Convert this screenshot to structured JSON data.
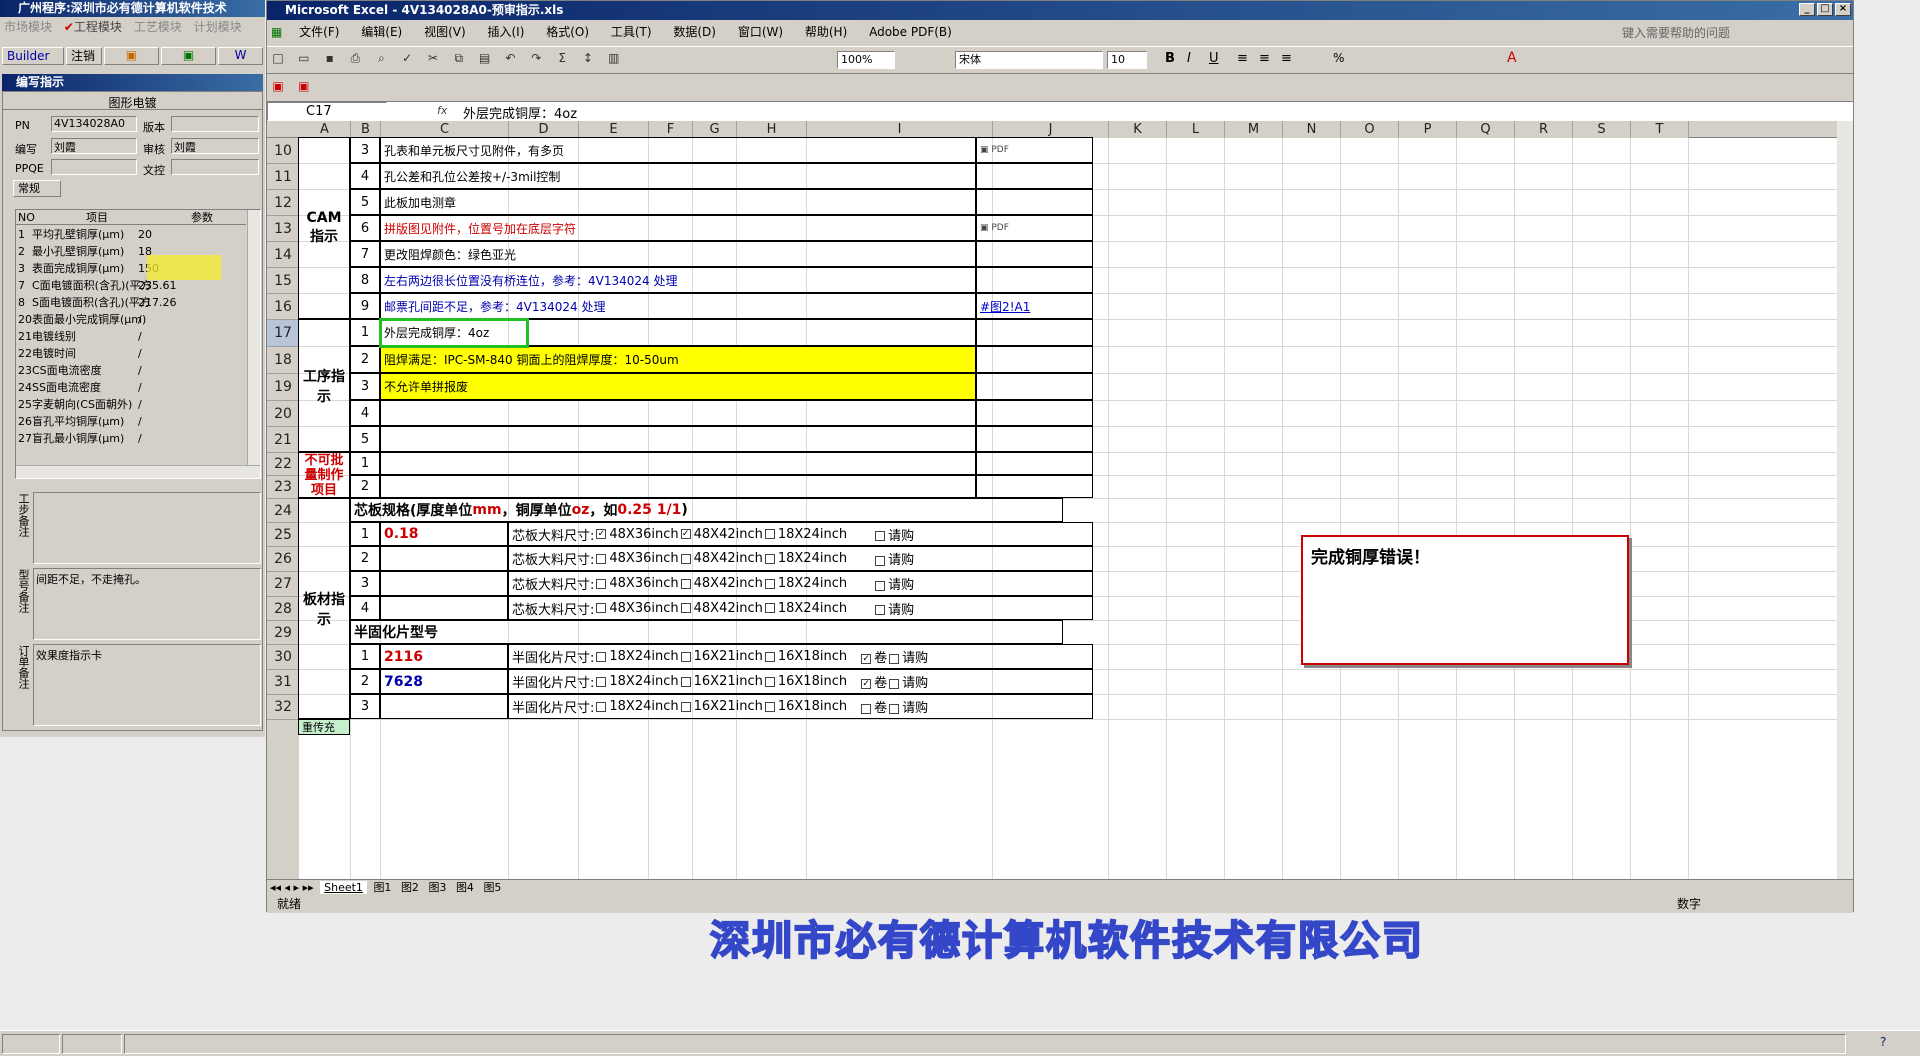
{
  "app": {
    "outer_title": "广州程序:深圳市必有德计算机软件技术",
    "outer_menu": [
      "市场模块",
      "工程模块",
      "工艺模块",
      "计划模块"
    ],
    "excel_title": "Microsoft Excel - 4V134028A0-预审指示.xls",
    "help_placeholder": "键入需要帮助的问题",
    "company_banner": "深圳市必有德计算机软件技术有限公司"
  },
  "left_panel": {
    "toolbar": [
      "Builder",
      "注销"
    ],
    "panel_title": "编写指示",
    "subtitle": "图形电镀",
    "fields": {
      "pn_label": "PN",
      "pn_value": "4V134028A0",
      "version_label": "版本",
      "version_value": "",
      "author_label": "编写",
      "author_value": "刘霞",
      "reviewer_label": "审核",
      "reviewer_value": "刘霞",
      "ppqe_label": "PPQE",
      "ppqe_value": "",
      "doc_label": "文控",
      "doc_value": ""
    },
    "tab_label": "常规",
    "table_headers": [
      "NO",
      "项目",
      "参数"
    ],
    "table_rows": [
      {
        "no": "1",
        "item": "平均孔壁铜厚(μm)",
        "val": "20"
      },
      {
        "no": "2",
        "item": "最小孔壁铜厚(μm)",
        "val": "18"
      },
      {
        "no": "3",
        "item": "表面完成铜厚(μm)",
        "val": "150"
      },
      {
        "no": "7",
        "item": "C面电镀面积(含孔)(平方",
        "val": "235.61"
      },
      {
        "no": "8",
        "item": "S面电镀面积(含孔)(平方",
        "val": "217.26"
      },
      {
        "no": "20",
        "item": "表面最小完成铜厚(μm)",
        "val": "/"
      },
      {
        "no": "21",
        "item": "电镀线别",
        "val": "/"
      },
      {
        "no": "22",
        "item": "电镀时间",
        "val": "/"
      },
      {
        "no": "23",
        "item": "CS面电流密度",
        "val": "/"
      },
      {
        "no": "24",
        "item": "SS面电流密度",
        "val": "/"
      },
      {
        "no": "25",
        "item": "字麦朝向(CS面朝外)",
        "val": "/"
      },
      {
        "no": "26",
        "item": "盲孔平均铜厚(μm)",
        "val": "/"
      },
      {
        "no": "27",
        "item": "盲孔最小铜厚(μm)",
        "val": "/"
      }
    ],
    "notes": [
      {
        "label": "工步备注",
        "text": ""
      },
      {
        "label": "型号备注",
        "text": "间距不足，不走掩孔。"
      },
      {
        "label": "订单备注",
        "text": "效果度指示卡"
      }
    ]
  },
  "excel": {
    "menu": [
      "文件(F)",
      "编辑(E)",
      "视图(V)",
      "插入(I)",
      "格式(O)",
      "工具(T)",
      "数据(D)",
      "窗口(W)",
      "帮助(H)",
      "Adobe PDF(B)"
    ],
    "zoom": "100%",
    "font_name": "宋体",
    "font_size": "10",
    "name_box": "C17",
    "fx": "fx",
    "formula": "外层完成铜厚：4oz",
    "col_headers": [
      "A",
      "B",
      "C",
      "D",
      "E",
      "F",
      "G",
      "H",
      "I",
      "J",
      "K",
      "L",
      "M",
      "N",
      "O",
      "P",
      "Q",
      "R",
      "S",
      "T"
    ],
    "row_numbers": [
      "10",
      "11",
      "12",
      "13",
      "14",
      "15",
      "16",
      "17",
      "18",
      "19",
      "20",
      "21",
      "22",
      "23",
      "24",
      "25",
      "26",
      "27",
      "28",
      "29",
      "30",
      "31",
      "32"
    ],
    "sections": {
      "cam": "CAM指示",
      "process": "工序指示",
      "nobatch": "不可批量制作项目",
      "material": "板材指示",
      "bottom": "重传充"
    },
    "cam_rows": [
      {
        "no": "3",
        "text": "孔表和单元板尺寸见附件，有多页",
        "link": ""
      },
      {
        "no": "4",
        "text": "孔公差和孔位公差按+/-3mil控制",
        "link": ""
      },
      {
        "no": "5",
        "text": "此板加电测章",
        "link": ""
      },
      {
        "no": "6",
        "text": "拼版图见附件，位置号加在底层字符",
        "link": ""
      },
      {
        "no": "7",
        "text": "更改阻焊颜色：绿色亚光",
        "link": ""
      },
      {
        "no": "8",
        "text": "左右两边很长位置没有桥连位，参考：4V134024 处理",
        "link": ""
      },
      {
        "no": "9",
        "text": "邮票孔间距不足，参考：4V134024 处理",
        "link": "#图2!A1"
      }
    ],
    "process_rows": [
      {
        "no": "1",
        "text": "外层完成铜厚：4oz"
      },
      {
        "no": "2",
        "text": "阻焊满足：IPC-SM-840 铜面上的阻焊厚度：10-50um"
      },
      {
        "no": "3",
        "text": "不允许单拼报废"
      },
      {
        "no": "4",
        "text": ""
      },
      {
        "no": "5",
        "text": ""
      }
    ],
    "nobatch_rows": [
      {
        "no": "1"
      },
      {
        "no": "2"
      }
    ],
    "core_header_a": "芯板规格(厚度单位",
    "core_header_mm": "mm",
    "core_header_b": "，铜厚单位",
    "core_header_oz": "oz",
    "core_header_c": "，如",
    "core_header_ex": "0.25 1/1",
    "core_header_d": ")",
    "core_label": "芯板大料尺寸:",
    "core_options": [
      "48X36inch",
      "48X42inch",
      "18X24inch",
      "请购"
    ],
    "core_rows": [
      {
        "no": "1",
        "spec": "0.18",
        "checks": [
          true,
          true,
          false,
          false
        ]
      },
      {
        "no": "2",
        "spec": "",
        "checks": [
          false,
          false,
          false,
          false
        ]
      },
      {
        "no": "3",
        "spec": "",
        "checks": [
          false,
          false,
          false,
          false
        ]
      },
      {
        "no": "4",
        "spec": "",
        "checks": [
          false,
          false,
          false,
          false
        ]
      }
    ],
    "pp_header": "半固化片型号",
    "pp_label": "半固化片尺寸:",
    "pp_options": [
      "18X24inch",
      "16X21inch",
      "16X18inch",
      "卷",
      "请购"
    ],
    "pp_rows": [
      {
        "no": "1",
        "spec": "2116",
        "color": "#cc0000",
        "checks": [
          false,
          false,
          false,
          true,
          false
        ]
      },
      {
        "no": "2",
        "spec": "7628",
        "color": "#0000aa",
        "checks": [
          false,
          false,
          false,
          true,
          false
        ]
      },
      {
        "no": "3",
        "spec": "",
        "color": "#000",
        "checks": [
          false,
          false,
          false,
          false,
          false
        ]
      }
    ],
    "comment": "完成铜厚错误！",
    "sheet_tabs": [
      "Sheet1",
      "图1",
      "图2",
      "图3",
      "图4",
      "图5"
    ],
    "status_left": "就绪",
    "status_right": "数字"
  }
}
